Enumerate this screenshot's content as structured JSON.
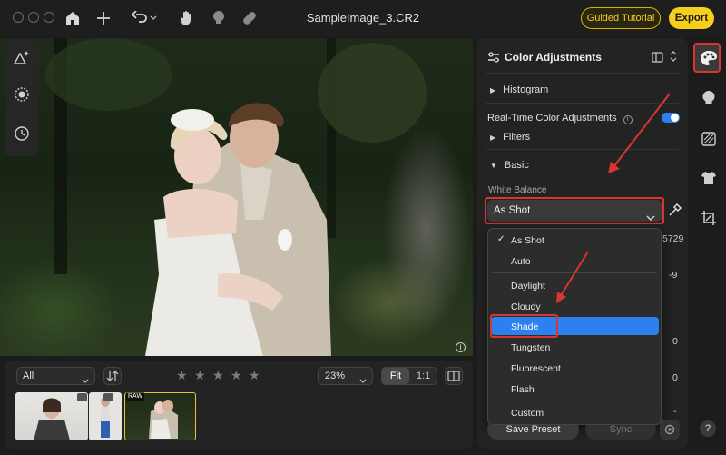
{
  "window": {
    "title": "SampleImage_3.CR2"
  },
  "toolbar": {
    "guided_label": "Guided Tutorial",
    "export_label": "Export"
  },
  "filmstrip": {
    "filter_value": "All",
    "zoom_value": "23%",
    "fit_label": "Fit",
    "one_to_one_label": "1:1",
    "raw_badge": "RAW",
    "rating": 0
  },
  "panel": {
    "title": "Color Adjustments",
    "histogram_label": "Histogram",
    "realtime_label": "Real-Time Color Adjustments",
    "realtime_info": "i",
    "filters_label": "Filters",
    "basic_label": "Basic",
    "white_balance_label": "White Balance",
    "white_balance_value": "As Shot",
    "save_preset_label": "Save Preset",
    "sync_label": "Sync",
    "behind_values": [
      "5729",
      "-9",
      "0",
      "0",
      "-"
    ]
  },
  "wb_menu": {
    "items": [
      {
        "label": "As Shot",
        "checked": true
      },
      {
        "label": "Auto"
      },
      {
        "label": "Daylight"
      },
      {
        "label": "Cloudy"
      },
      {
        "label": "Shade",
        "highlighted": true
      },
      {
        "label": "Tungsten"
      },
      {
        "label": "Fluorescent"
      },
      {
        "label": "Flash"
      },
      {
        "label": "Custom"
      }
    ]
  },
  "photo": {
    "info_icon_text": "i"
  },
  "help_label": "?",
  "colors": {
    "accent": "#2d80f0",
    "export_yellow": "#f6cf1d",
    "annotation_red": "#d9362f"
  }
}
